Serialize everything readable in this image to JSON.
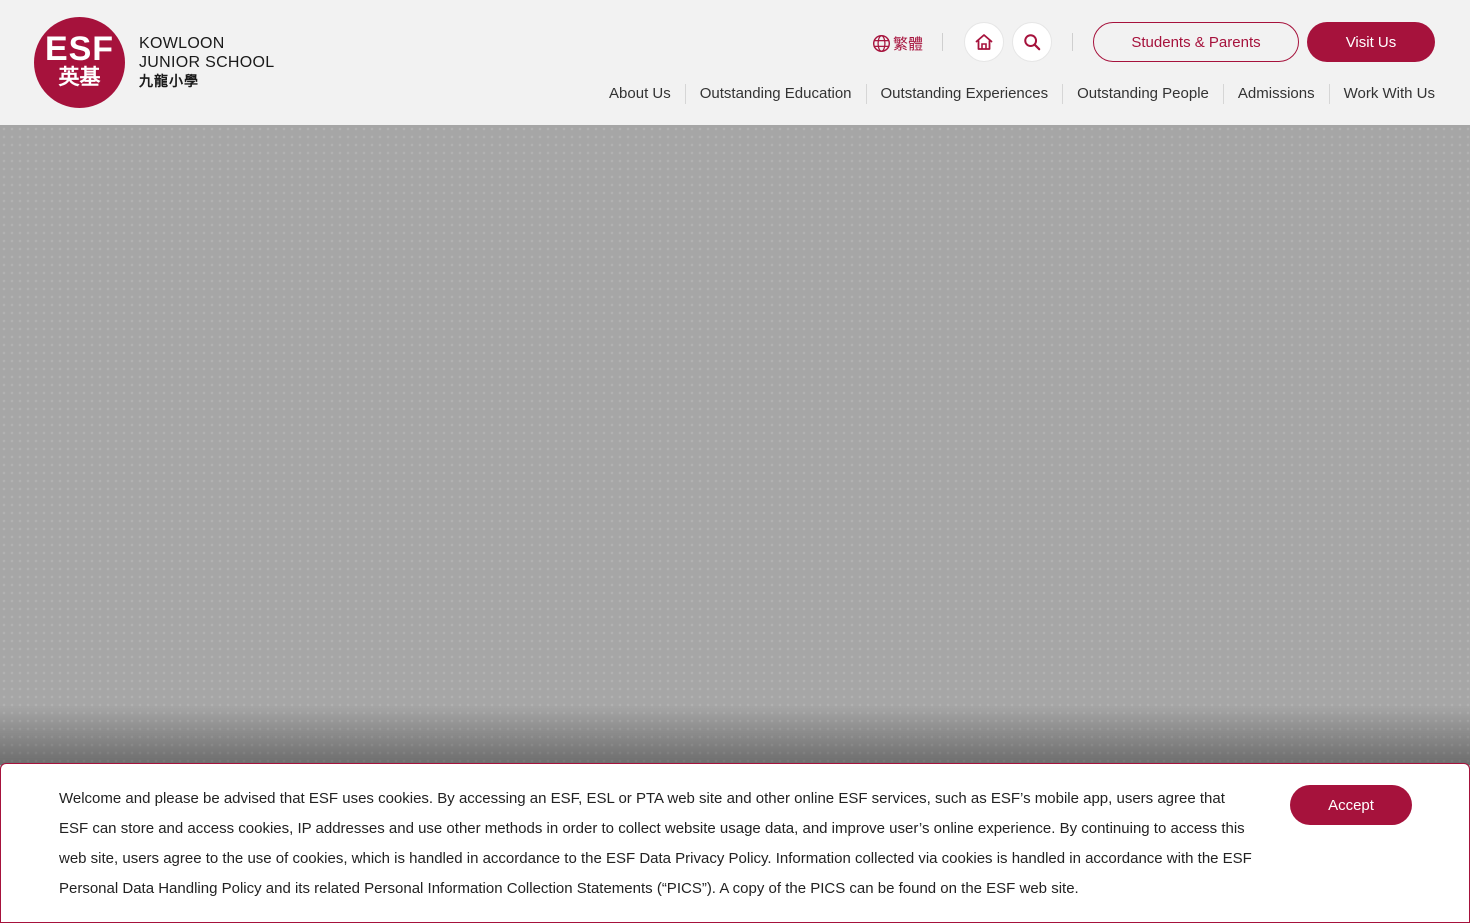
{
  "logo": {
    "esf": "ESF",
    "chinese": "英基",
    "line1": "KOWLOON",
    "line2": "JUNIOR SCHOOL",
    "line3": "九龍小學"
  },
  "header": {
    "language_label": "繁體",
    "home_icon": "home-icon",
    "search_icon": "search-icon",
    "students_parents_label": "Students & Parents",
    "visit_us_label": "Visit Us"
  },
  "nav": {
    "items": [
      {
        "label": "About Us"
      },
      {
        "label": "Outstanding Education"
      },
      {
        "label": "Outstanding Experiences"
      },
      {
        "label": "Outstanding People"
      },
      {
        "label": "Admissions"
      },
      {
        "label": "Work With Us"
      }
    ]
  },
  "cookie": {
    "text": "Welcome and please be advised that ESF uses cookies. By accessing an ESF, ESL or PTA web site and other online ESF services, such as ESF’s mobile app, users agree that ESF can store and access cookies, IP addresses and use other methods in order to collect website usage data, and improve user’s online experience. By continuing to access this web site, users agree to the use of cookies, which is handled in accordance to the ESF Data Privacy Policy. Information collected via cookies is handled in accordance with the ESF Personal Data Handling Policy and its related Personal Information Collection Statements (“PICS”). A copy of the PICS can be found on the ESF web site.",
    "accept_label": "Accept"
  },
  "colors": {
    "brand": "#a6123c",
    "header_bg": "#f2f2f2",
    "hero_bg": "#a6a6a6"
  }
}
